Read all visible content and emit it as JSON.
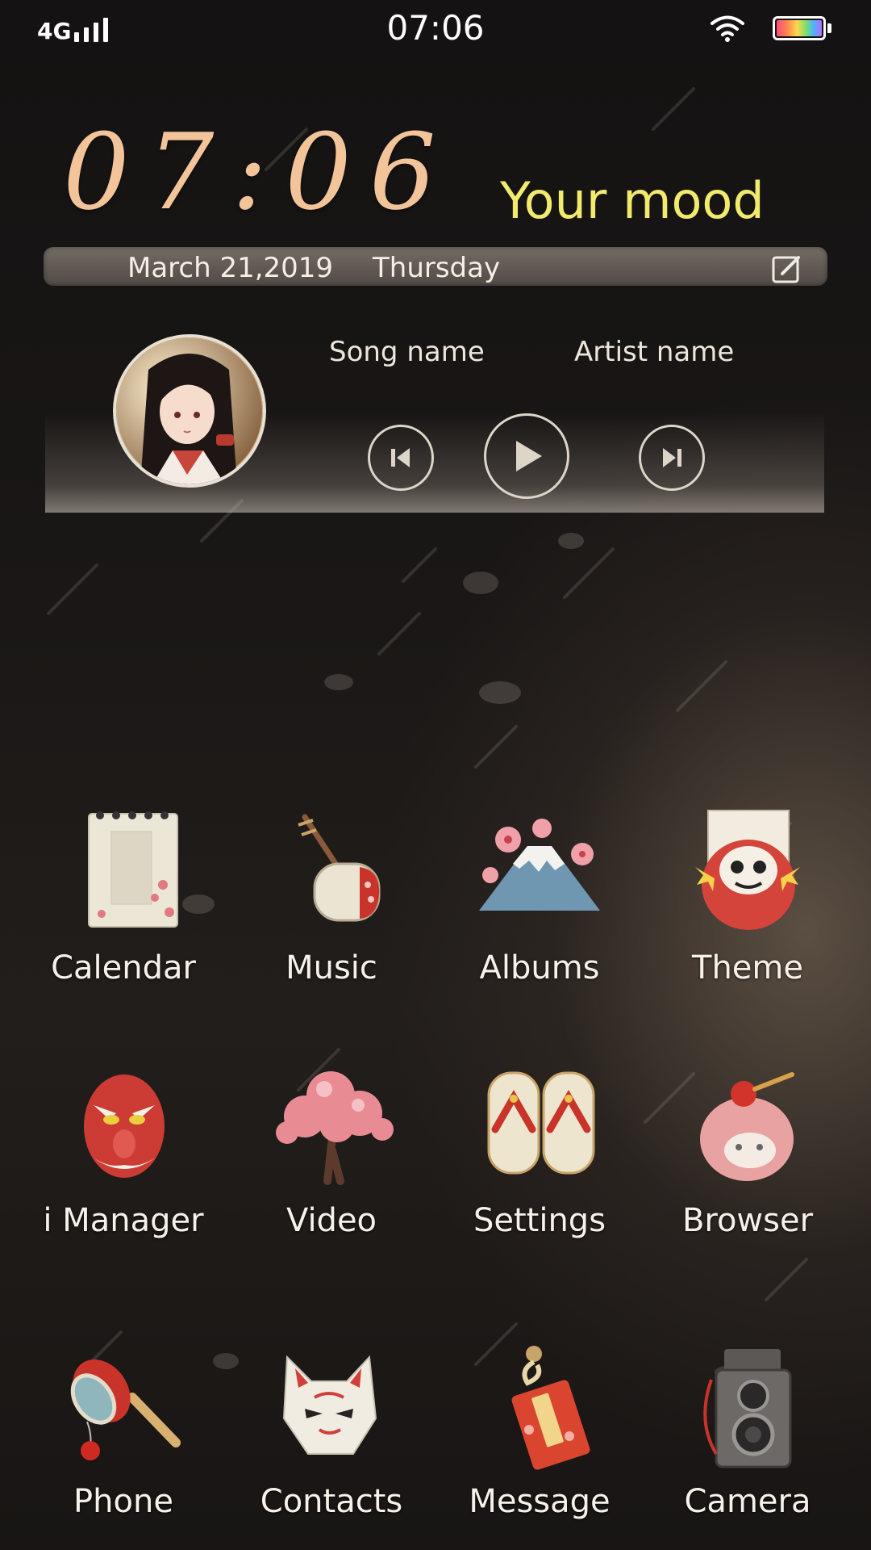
{
  "status_bar": {
    "network": "4G",
    "time": "07:06"
  },
  "clock_widget": {
    "time": "07:06",
    "mood": "Your mood",
    "date": "March 21,2019",
    "weekday": "Thursday"
  },
  "music_widget": {
    "song_name": "Song name",
    "artist_name": "Artist name"
  },
  "apps": [
    {
      "label": "Calendar",
      "icon": "calendar-icon"
    },
    {
      "label": "Music",
      "icon": "shamisen-icon"
    },
    {
      "label": "Albums",
      "icon": "mount-fuji-icon"
    },
    {
      "label": "Theme",
      "icon": "daruma-icon"
    },
    {
      "label": "i Manager",
      "icon": "tengu-mask-icon"
    },
    {
      "label": "Video",
      "icon": "sakura-tree-icon"
    },
    {
      "label": "Settings",
      "icon": "geta-sandals-icon"
    },
    {
      "label": "Browser",
      "icon": "rice-cake-icon"
    },
    {
      "label": "Phone",
      "icon": "den-den-drum-icon"
    },
    {
      "label": "Contacts",
      "icon": "fox-mask-icon"
    },
    {
      "label": "Message",
      "icon": "omamori-charm-icon"
    },
    {
      "label": "Camera",
      "icon": "retro-camera-icon"
    }
  ],
  "colors": {
    "clock": "#f3c49a",
    "mood": "#f1ea6c",
    "accent_red": "#d4443a"
  }
}
